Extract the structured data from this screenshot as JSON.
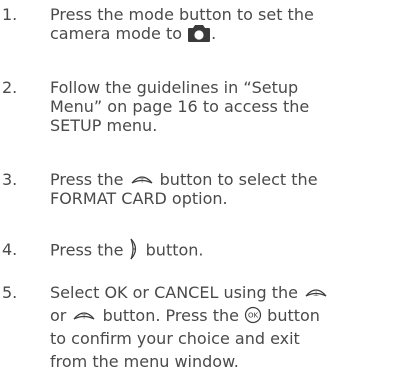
{
  "steps": [
    {
      "number": "1.",
      "lines": [
        "Press the mode button to set the",
        "camera mode to",
        "."
      ]
    },
    {
      "number": "2.",
      "lines": [
        "Follow the guidelines in “Setup",
        "Menu” on page 16 to access the",
        "SETUP menu."
      ]
    },
    {
      "number": "3.",
      "lines": [
        "Press the",
        "button to select the",
        "FORMAT CARD option."
      ]
    },
    {
      "number": "4.",
      "lines": [
        "Press the",
        "button."
      ]
    },
    {
      "number": "5.",
      "lines": [
        "Select OK or CANCEL using the",
        "or",
        "button. Press the",
        "button",
        "to confirm your choice and exit",
        "from the menu window."
      ]
    }
  ],
  "icons": {
    "camera": "camera-icon",
    "down_dial": "down-dial-icon",
    "up_dial": "up-dial-icon",
    "menu": "menu-button-icon",
    "ok": "ok-button-icon"
  },
  "colors": {
    "text": "#4a4a4a",
    "icon": "#3a3a3a"
  }
}
